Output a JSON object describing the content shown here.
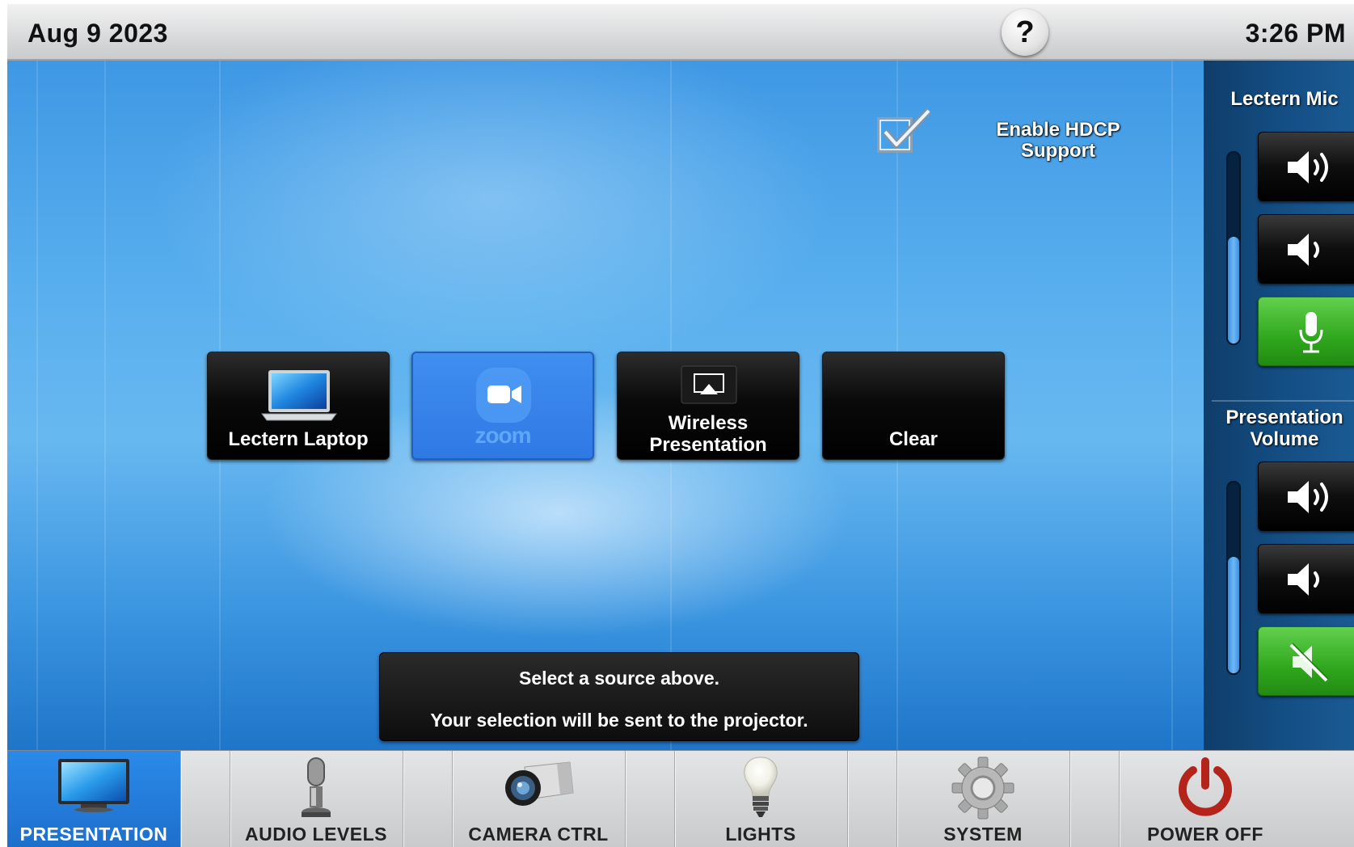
{
  "topbar": {
    "date": "Aug 9 2023",
    "time": "3:26 PM",
    "help_label": "?"
  },
  "main": {
    "hdcp": {
      "label": "Enable HDCP Support",
      "checked": true
    },
    "sources": [
      {
        "label": "Lectern Laptop",
        "icon": "laptop-icon",
        "selected": false
      },
      {
        "label": "zoom",
        "icon": "zoom-icon",
        "selected": true
      },
      {
        "label": "Wireless Presentation",
        "icon": "airplay-icon",
        "selected": false
      },
      {
        "label": "Clear",
        "icon": "",
        "selected": false
      }
    ],
    "message": {
      "line1": "Select a source above.",
      "line2": "Your selection will be sent to the projector."
    }
  },
  "right_panel": {
    "lectern_mic": {
      "title": "Lectern Mic",
      "level": 0.55,
      "muted": false
    },
    "presentation_volume": {
      "title_line1": "Presentation",
      "title_line2": "Volume",
      "level": 0.6,
      "muted": true
    }
  },
  "nav": [
    {
      "label": "PRESENTATION",
      "icon": "monitor-icon",
      "active": true
    },
    {
      "label": "AUDIO LEVELS",
      "icon": "microphone-icon",
      "active": false
    },
    {
      "label": "CAMERA CTRL",
      "icon": "camera-icon",
      "active": false
    },
    {
      "label": "LIGHTS",
      "icon": "lightbulb-icon",
      "active": false
    },
    {
      "label": "SYSTEM",
      "icon": "gear-icon",
      "active": false
    },
    {
      "label": "POWER OFF",
      "icon": "power-icon",
      "active": false
    }
  ],
  "colors": {
    "accent_blue": "#2b8ae8",
    "active_green": "#3fb52a",
    "power_red": "#c0281e"
  }
}
